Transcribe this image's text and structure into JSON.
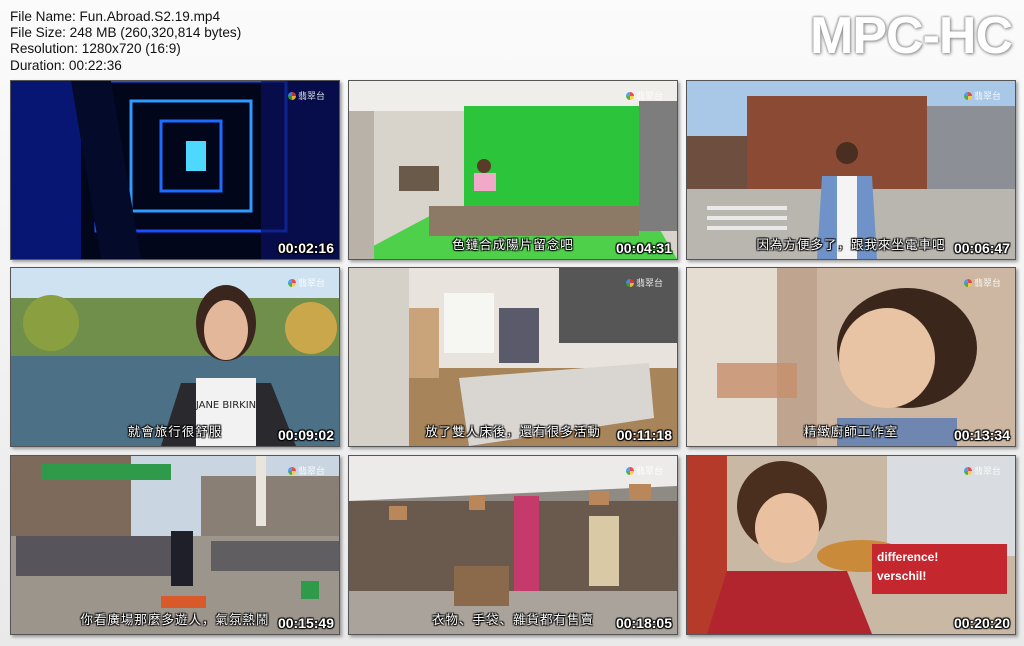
{
  "info": {
    "file_name": "File Name: Fun.Abroad.S2.19.mp4",
    "file_size": "File Size: 248 MB (260,320,814 bytes)",
    "resolution": "Resolution: 1280x720 (16:9)",
    "duration": "Duration: 00:22:36"
  },
  "logo": "MPC-HC",
  "watermark": "翡翠台",
  "thumbs": [
    {
      "time": "00:02:16",
      "subtitle": ""
    },
    {
      "time": "00:04:31",
      "subtitle": "色鏈合成陽片留念吧"
    },
    {
      "time": "00:06:47",
      "subtitle": "因為方便多了，跟我來坐電車吧"
    },
    {
      "time": "00:09:02",
      "subtitle": "就會旅行很舒服"
    },
    {
      "time": "00:11:18",
      "subtitle": "放了雙人床後，還有很多活動"
    },
    {
      "time": "00:13:34",
      "subtitle": "精緻廚師工作室"
    },
    {
      "time": "00:15:49",
      "subtitle": "你看廣場那麼多遊人，氣氛熱鬧"
    },
    {
      "time": "00:18:05",
      "subtitle": "衣物、手袋、雜貨都有售賣"
    },
    {
      "time": "00:20:20",
      "subtitle": ""
    }
  ],
  "sign_text": [
    "difference!",
    "verschil!"
  ]
}
